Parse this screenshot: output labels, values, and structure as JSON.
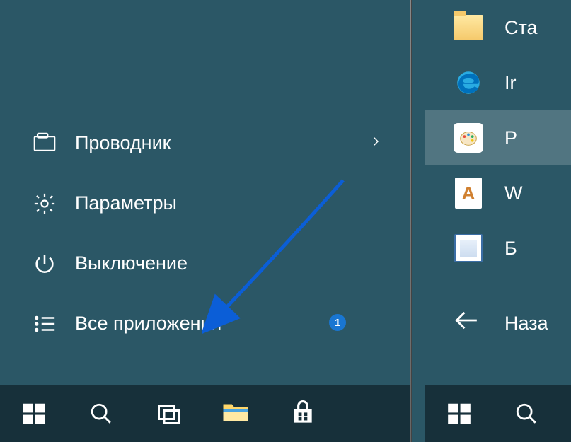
{
  "leftMenu": {
    "explorer": "Проводник",
    "settings": "Параметры",
    "power": "Выключение",
    "allApps": "Все приложения"
  },
  "rightApps": {
    "item0": "Ста",
    "item1": "Ir",
    "item2": "P",
    "item3": "W",
    "item4": "Б",
    "back": "Наза"
  },
  "annotation": {
    "badgeNumber": "1"
  }
}
